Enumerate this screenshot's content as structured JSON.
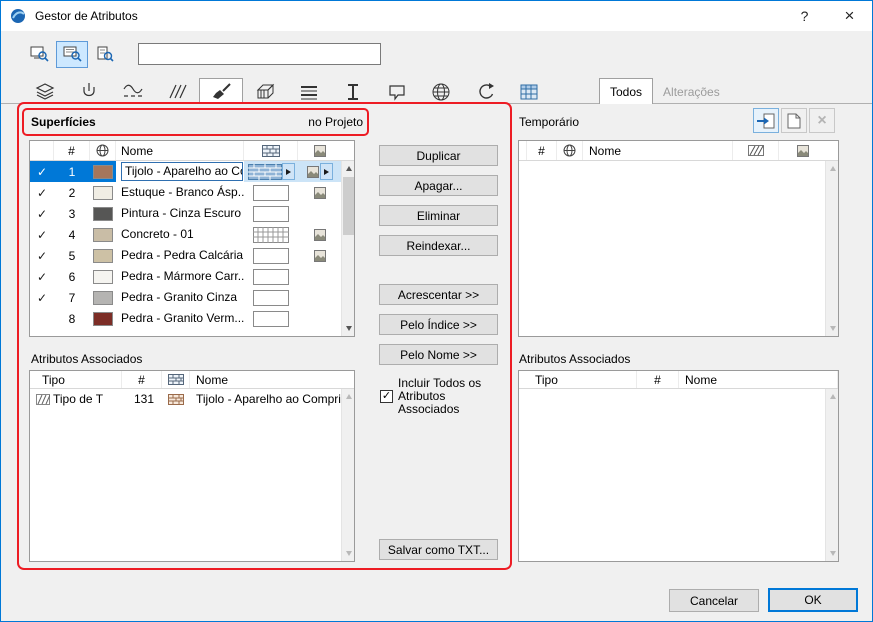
{
  "window": {
    "title": "Gestor de Atributos",
    "help": "?",
    "close": "×"
  },
  "toolbar": {
    "search_value": ""
  },
  "tabs": {
    "icon_tabs": [
      "layers",
      "pens",
      "line-types",
      "fill-types",
      "surfaces",
      "composites",
      "hatching",
      "profiles",
      "zone-stamps",
      "globe",
      "operation-profiles",
      "schedules"
    ],
    "active_icon_tab": "surfaces",
    "todos": "Todos",
    "alteracoes": "Alterações"
  },
  "left_panel": {
    "title": "Superfícies",
    "scope": "no Projeto",
    "columns": {
      "num": "#",
      "name": "Nome"
    },
    "rows": [
      {
        "check": "✓",
        "num": "1",
        "name": "Tijolo - Aparelho ao Cc",
        "swatch": "#a5765b",
        "preview": "brick",
        "selected": true
      },
      {
        "check": "✓",
        "num": "2",
        "name": "Estuque - Branco Ásp...",
        "swatch": "#f0ede4",
        "preview": "plain"
      },
      {
        "check": "✓",
        "num": "3",
        "name": "Pintura - Cinza Escuro",
        "swatch": "#565655",
        "preview": "plain"
      },
      {
        "check": "✓",
        "num": "4",
        "name": "Concreto - 01",
        "swatch": "#c9bda6",
        "preview": "grid"
      },
      {
        "check": "✓",
        "num": "5",
        "name": "Pedra - Pedra Calcária...",
        "swatch": "#cdc1a5",
        "preview": "plain"
      },
      {
        "check": "✓",
        "num": "6",
        "name": "Pedra - Mármore Carr...",
        "swatch": "#f5f4f0",
        "preview": "plain"
      },
      {
        "check": "✓",
        "num": "7",
        "name": "Pedra - Granito Cinza",
        "swatch": "#b5b4b2",
        "preview": "plain"
      },
      {
        "check": "",
        "num": "8",
        "name": "Pedra - Granito Verm...",
        "swatch": "#7c2d26",
        "preview": "plain"
      }
    ],
    "assoc_title": "Atributos Associados",
    "assoc_columns": {
      "tipo": "Tipo",
      "num": "#",
      "name": "Nome"
    },
    "assoc_rows": [
      {
        "tipo": "Tipo de T",
        "num": "131",
        "name": "Tijolo - Aparelho ao Compri..."
      }
    ]
  },
  "actions": {
    "duplicar": "Duplicar",
    "apagar": "Apagar...",
    "eliminar": "Eliminar",
    "reindexar": "Reindexar...",
    "acrescentar": "Acrescentar >>",
    "pelo_indice": "Pelo Índice >>",
    "pelo_nome": "Pelo Nome >>",
    "incluir_check": "✓",
    "incluir": "Incluir Todos os Atributos Associados",
    "salvar": "Salvar como TXT..."
  },
  "right_panel": {
    "title": "Temporário",
    "columns": {
      "num": "#",
      "name": "Nome"
    },
    "assoc_title": "Atributos Associados",
    "assoc_columns": {
      "tipo": "Tipo",
      "num": "#",
      "name": "Nome"
    }
  },
  "footer": {
    "cancel": "Cancelar",
    "ok": "OK"
  },
  "colors": {
    "accent": "#0078d7",
    "selection": "#0078d7",
    "selection_light": "#cce4f7",
    "annotation": "#ed1c24"
  },
  "icons": {
    "app": "archicad-sphere",
    "toolbar": [
      "screen-magnifier",
      "screen-magnifier-active",
      "list-magnifier"
    ],
    "table_header": [
      "globe",
      "brick-pattern",
      "hatch-pattern",
      "texture-swatch"
    ],
    "temporario_buttons": [
      "import-page",
      "new-page",
      "delete-x"
    ]
  }
}
